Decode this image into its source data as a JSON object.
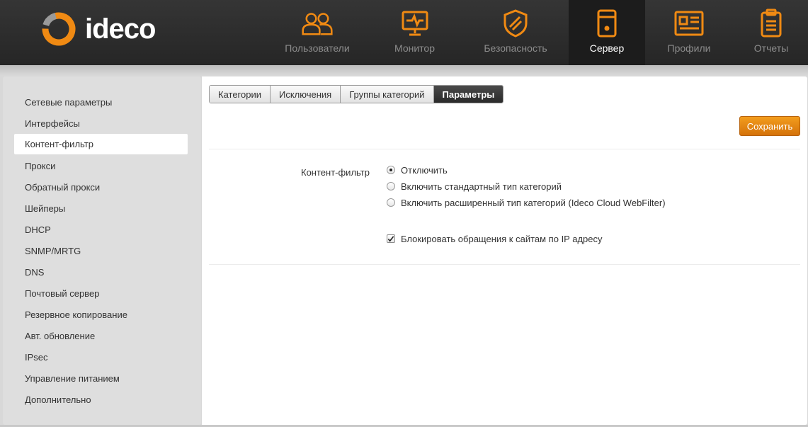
{
  "brand": {
    "logo_text": "ideco",
    "accent_color": "#f08a13"
  },
  "nav": [
    {
      "label": "Пользователи",
      "icon": "users-icon",
      "active": false
    },
    {
      "label": "Монитор",
      "icon": "monitor-icon",
      "active": false
    },
    {
      "label": "Безопасность",
      "icon": "shield-icon",
      "active": false
    },
    {
      "label": "Сервер",
      "icon": "server-icon",
      "active": true
    },
    {
      "label": "Профили",
      "icon": "profile-card-icon",
      "active": false
    },
    {
      "label": "Отчеты",
      "icon": "clipboard-icon",
      "active": false
    }
  ],
  "sidebar": {
    "active_index": 2,
    "items": [
      {
        "label": "Сетевые параметры"
      },
      {
        "label": "Интерфейсы"
      },
      {
        "label": "Контент-фильтр"
      },
      {
        "label": "Прокси"
      },
      {
        "label": "Обратный прокси"
      },
      {
        "label": "Шейперы"
      },
      {
        "label": "DHCP"
      },
      {
        "label": "SNMP/MRTG"
      },
      {
        "label": "DNS"
      },
      {
        "label": "Почтовый сервер"
      },
      {
        "label": "Резервное копирование"
      },
      {
        "label": "Авт. обновление"
      },
      {
        "label": "IPsec"
      },
      {
        "label": "Управление питанием"
      },
      {
        "label": "Дополнительно"
      }
    ]
  },
  "tabs": [
    {
      "label": "Категории",
      "active": false
    },
    {
      "label": "Исключения",
      "active": false
    },
    {
      "label": "Группы категорий",
      "active": false
    },
    {
      "label": "Параметры",
      "active": true
    }
  ],
  "toolbar": {
    "save_label": "Сохранить"
  },
  "form": {
    "content_filter_label": "Контент-фильтр",
    "options": [
      {
        "label": "Отключить",
        "checked": true
      },
      {
        "label": "Включить стандартный тип категорий",
        "checked": false
      },
      {
        "label": "Включить расширенный тип категорий (Ideco Cloud WebFilter)",
        "checked": false
      }
    ],
    "block_ip": {
      "label": "Блокировать обращения к сайтам по IP адресу",
      "checked": true
    }
  }
}
